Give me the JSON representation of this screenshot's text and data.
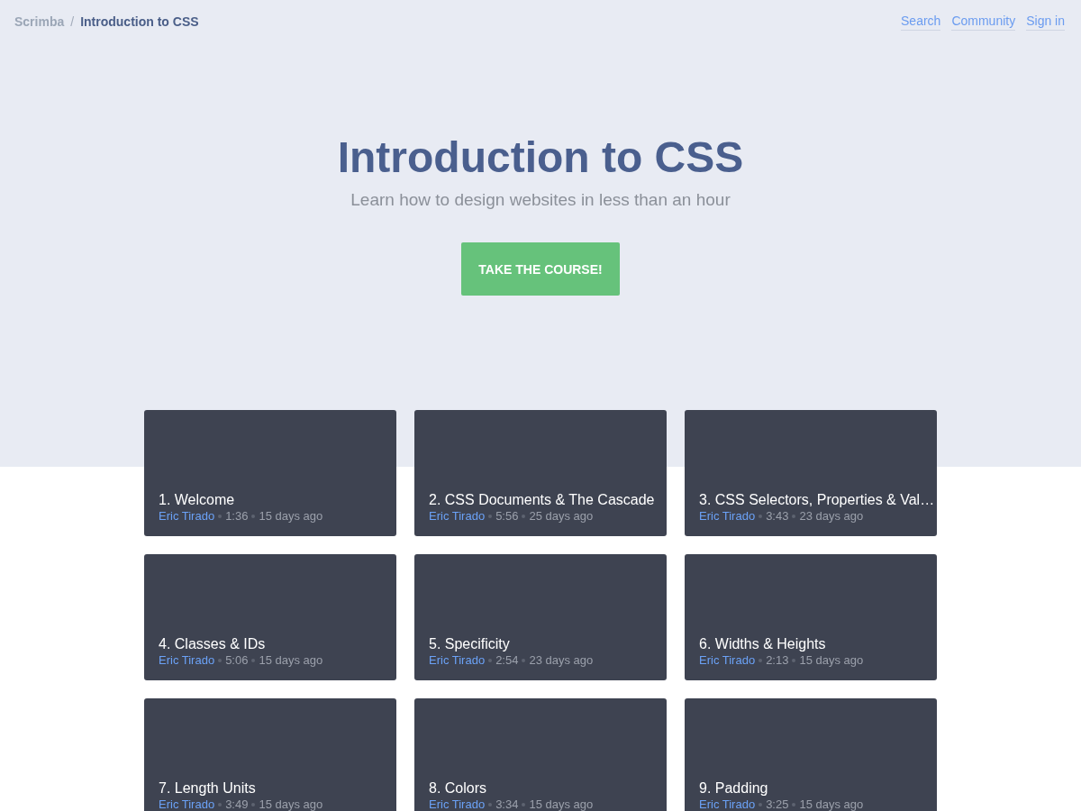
{
  "breadcrumb": {
    "site": "Scrimba",
    "separator": "/",
    "current": "Introduction to CSS"
  },
  "nav_links": [
    "Search",
    "Community",
    "Sign in"
  ],
  "hero": {
    "title": "Introduction to CSS",
    "subtitle": "Learn how to design websites in less than an hour",
    "button": "TAKE THE COURSE!"
  },
  "lessons": [
    {
      "title": "1. Welcome",
      "author": "Eric Tirado",
      "duration": "1:36",
      "age": "15 days ago"
    },
    {
      "title": "2. CSS Documents & The Cascade",
      "author": "Eric Tirado",
      "duration": "5:56",
      "age": "25 days ago"
    },
    {
      "title": "3. CSS Selectors, Properties & Val…",
      "author": "Eric Tirado",
      "duration": "3:43",
      "age": "23 days ago"
    },
    {
      "title": "4. Classes & IDs",
      "author": "Eric Tirado",
      "duration": "5:06",
      "age": "15 days ago"
    },
    {
      "title": "5. Specificity",
      "author": "Eric Tirado",
      "duration": "2:54",
      "age": "23 days ago"
    },
    {
      "title": "6. Widths & Heights",
      "author": "Eric Tirado",
      "duration": "2:13",
      "age": "15 days ago"
    },
    {
      "title": "7. Length Units",
      "author": "Eric Tirado",
      "duration": "3:49",
      "age": "15 days ago"
    },
    {
      "title": "8. Colors",
      "author": "Eric Tirado",
      "duration": "3:34",
      "age": "15 days ago"
    },
    {
      "title": "9. Padding",
      "author": "Eric Tirado",
      "duration": "3:25",
      "age": "15 days ago"
    }
  ]
}
